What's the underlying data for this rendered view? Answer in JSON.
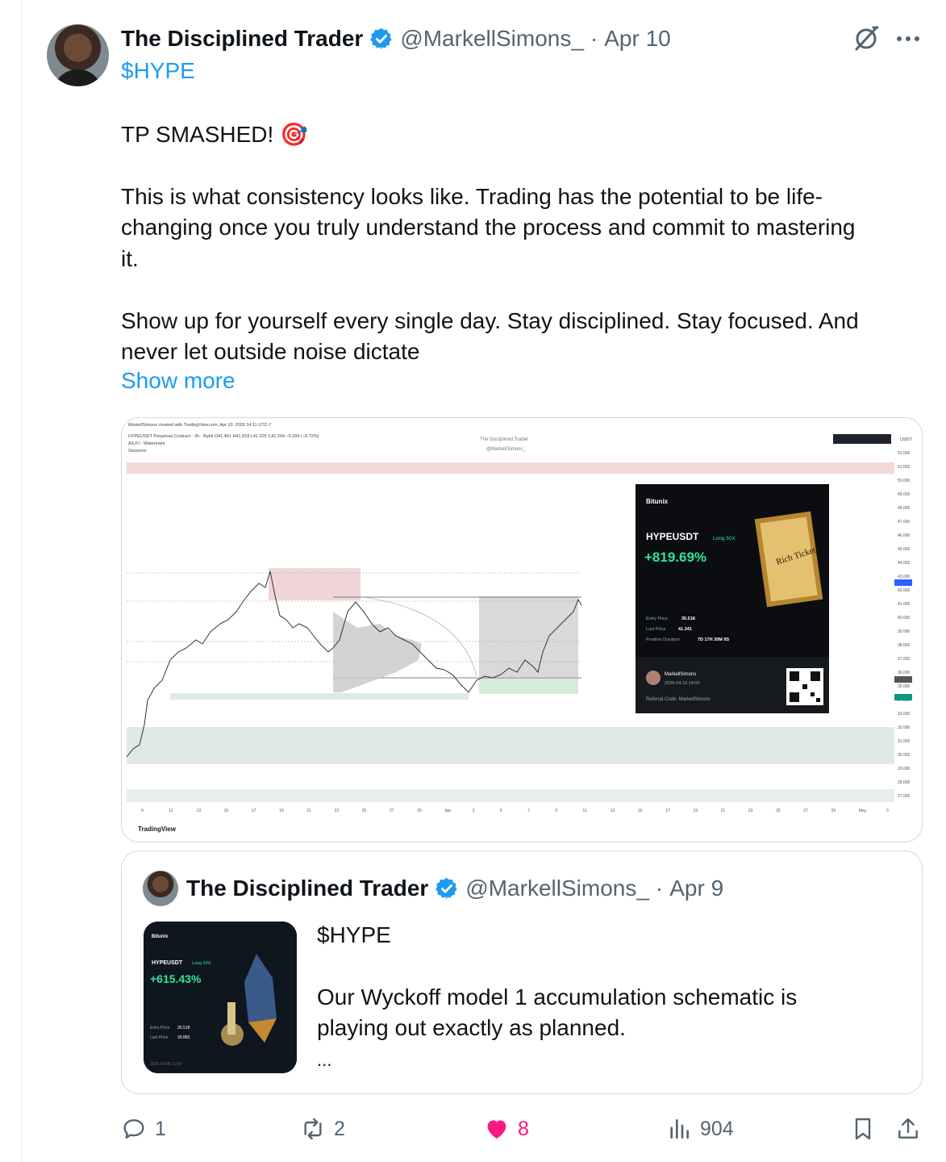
{
  "tweet": {
    "author_name": "The Disciplined Trader",
    "handle": "@MarkellSimons_",
    "separator": "·",
    "date": "Apr 10",
    "cashtag": "$HYPE",
    "line_tp": "TP SMASHED! 🎯",
    "para1_line1": "This is what consistency looks like. Trading has the potential to be life-",
    "para1_line2": "changing once you truly understand the process and commit to mastering",
    "para1_line3": "it.",
    "para2_line1": "Show up for yourself every single day. Stay disciplined. Stay focused. And",
    "para2_line2": "never let outside noise dictate",
    "show_more": "Show more"
  },
  "chart_image": {
    "header_line1": "MarkellSimons created with TradingView.com, Apr 10, 2026 14:11 UTC-7",
    "header_line2": "HYPEUSDT Perpetual Contract · 2h · Bybit  O41.451 H41.818 L41.325 C41.294 −0.299 (−0.72%)",
    "header_line3": "AS-FI · Watermark",
    "header_line4": "Sessions",
    "watermark_title": "The Disciplined Trader",
    "watermark_handle": "@MarkellSimons_",
    "currency": "USDT",
    "tradingview_logo": "TradingView",
    "price_ticks": [
      "52.000",
      "51.000",
      "50.000",
      "49.000",
      "48.000",
      "47.000",
      "46.000",
      "45.000",
      "44.000",
      "43.000",
      "42.000",
      "41.000",
      "40.000",
      "39.000",
      "38.000",
      "37.000",
      "36.000",
      "35.000",
      "34.000",
      "33.000",
      "32.000",
      "31.000",
      "30.000",
      "29.000",
      "28.000",
      "27.000"
    ],
    "date_ticks": [
      "9",
      "11",
      "13",
      "15",
      "17",
      "19",
      "21",
      "23",
      "25",
      "27",
      "29",
      "Apr",
      "3",
      "5",
      "7",
      "9",
      "11",
      "13",
      "15",
      "17",
      "19",
      "21",
      "23",
      "25",
      "27",
      "29",
      "May",
      "3"
    ],
    "pnl_card": {
      "exchange": "Bitunix",
      "pair": "HYPEUSDT",
      "position": "Long 50X",
      "pnl": "+819.69%",
      "ticket_text": "Rich Tickets",
      "entry_label": "Entry Price",
      "entry_value": "35.518",
      "last_label": "Last Price",
      "last_value": "41.341",
      "duration_label": "Position Duration",
      "duration_value": "7D 17H 30M 9S",
      "user": "MarkellSimons",
      "timestamp": "2026-04-10 14:09",
      "referral": "Referral Code: MarkellSimons"
    }
  },
  "quote": {
    "author_name": "The Disciplined Trader",
    "handle": "@MarkellSimons_",
    "separator": "·",
    "date": "Apr 9",
    "cashtag": "$HYPE",
    "line1": "Our Wyckoff model 1 accumulation schematic is",
    "line2": "playing out exactly as planned.",
    "ellipsis": "...",
    "thumb": {
      "exchange": "Bitunix",
      "pair": "HYPEUSDT",
      "position": "Long 50X",
      "pnl": "+615.43%",
      "entry_label": "Entry Price",
      "entry_value": "35.518",
      "last_label": "Last Price",
      "last_value": "39.883",
      "timestamp": "2026-04-09 11:53"
    }
  },
  "actions": {
    "replies": "1",
    "reposts": "2",
    "likes": "8",
    "views": "904"
  },
  "colors": {
    "accent": "#1d9bf0",
    "like": "#f91880",
    "muted": "#536471",
    "pnl_green": "#2ee59d"
  }
}
